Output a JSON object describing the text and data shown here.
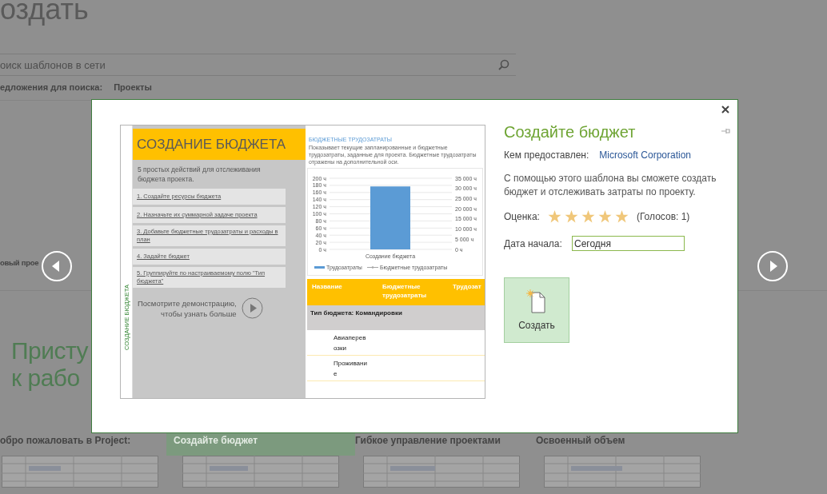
{
  "background": {
    "title": "оздать",
    "search": {
      "placeholder": "оиск шаблонов в сети"
    },
    "suggestions": {
      "label": "едложения для поиска:",
      "items": [
        "Проекты"
      ]
    },
    "section_label": "овый прое",
    "welcome": [
      "Присту",
      "к рабо"
    ],
    "templates": [
      {
        "title": "обро пожаловать в Project:",
        "selected": false
      },
      {
        "title": "Создайте бюджет",
        "selected": true
      },
      {
        "title": "Гибкое управление проектами",
        "selected": false
      },
      {
        "title": "Освоенный объем",
        "selected": false
      }
    ]
  },
  "dialog": {
    "preview": {
      "side_label": "СОЗДАНИЕ БЮДЖЕТА",
      "title": "СОЗДАНИЕ БЮДЖЕТА",
      "intro": "5 простых действий для отслеживания бюджета проекта.",
      "steps": [
        "1. Создайте ресурсы бюджета",
        "2. Назначьте их суммарной задаче проекта",
        "3. Добавьте бюджетные трудозатраты и расходы в план",
        "4. Задайте бюджет",
        "5. Группируйте по настраиваемому полю \"Тип бюджета\""
      ],
      "demo": [
        "Посмотрите демонстрацию,",
        "чтобы узнать больше"
      ],
      "chart_heading": "БЮДЖЕТНЫЕ ТРУДОЗАТРАТЫ",
      "chart_description": "Показывает текущие запланированные и бюджетные трудозатраты, заданные для проекта. Бюджетные трудозатраты отражены на дополнительной оси.",
      "chart_data": {
        "type": "bar",
        "categories": [
          "Создание бюджета"
        ],
        "series": [
          {
            "name": "Трудозатраты",
            "color": "#5b9bd5",
            "values": [
              177
            ]
          },
          {
            "name": "Бюджетные трудозатраты",
            "color": "#a5a5a5",
            "values": [
              null
            ]
          }
        ],
        "grid": true,
        "ylim": [
          0,
          200
        ],
        "yticks": [
          {
            "value": 0,
            "label": "0 ч"
          },
          {
            "value": 20,
            "label": "20 ч"
          },
          {
            "value": 40,
            "label": "40 ч"
          },
          {
            "value": 60,
            "label": "60 ч"
          },
          {
            "value": 80,
            "label": "80 ч"
          },
          {
            "value": 100,
            "label": "100 ч"
          },
          {
            "value": 120,
            "label": "120 ч"
          },
          {
            "value": 140,
            "label": "140 ч"
          },
          {
            "value": 160,
            "label": "160 ч"
          },
          {
            "value": 180,
            "label": "180 ч"
          },
          {
            "value": 200,
            "label": "200 ч"
          }
        ]
      },
      "secondary_axis_labels": [
        "35 000 ч",
        "30 000 ч",
        "25 000 ч",
        "20 000 ч",
        "15 000 ч",
        "10 000 ч",
        "5 000 ч",
        "0 ч"
      ],
      "table": {
        "columns": [
          "Название",
          "Бюджетные трудозатраты",
          "Трудозат"
        ],
        "group": "Тип бюджета: Командировки",
        "rows": [
          "Авиаперевозки",
          "Проживание"
        ]
      }
    },
    "title": "Создайте бюджет",
    "provider_label": "Кем предоставлен:",
    "provider": "Microsoft Corporation",
    "description": "С помощью этого шаблона вы сможете создать бюджет и отслеживать затраты по проекту.",
    "rating": {
      "label": "Оценка:",
      "stars": 5,
      "votes": "(Голосов: 1)"
    },
    "start_date": {
      "label": "Дата начала:",
      "value": "Сегодня"
    },
    "create_button": "Создать"
  }
}
